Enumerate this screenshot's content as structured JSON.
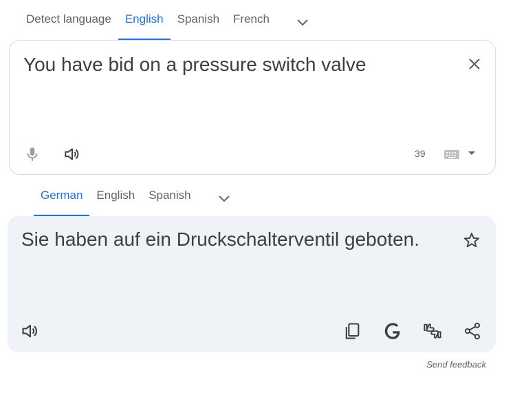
{
  "source_langs": {
    "tabs": [
      "Detect language",
      "English",
      "Spanish",
      "French"
    ],
    "active_index": 1,
    "more_icon": "chevron-down-icon"
  },
  "source": {
    "text": "You have bid on a pressure switch valve",
    "char_count": "39",
    "icons": [
      "close-icon",
      "mic-icon",
      "speaker-icon",
      "keyboard-icon",
      "dropdown-arrow-icon"
    ]
  },
  "target_langs": {
    "tabs": [
      "German",
      "English",
      "Spanish"
    ],
    "active_index": 0,
    "more_icon": "chevron-down-icon"
  },
  "target": {
    "text": "Sie haben auf ein Druckschalterventil geboten.",
    "icons": [
      "star-icon",
      "speaker-icon",
      "copy-icon",
      "google-icon",
      "rate-icon",
      "share-icon"
    ]
  },
  "footer": {
    "feedback": "Send feedback"
  },
  "colors": {
    "accent": "#1a73e8",
    "text": "#3c4043",
    "muted": "#5f6368",
    "target_bg": "#eff2f6",
    "border": "#dadce0"
  }
}
